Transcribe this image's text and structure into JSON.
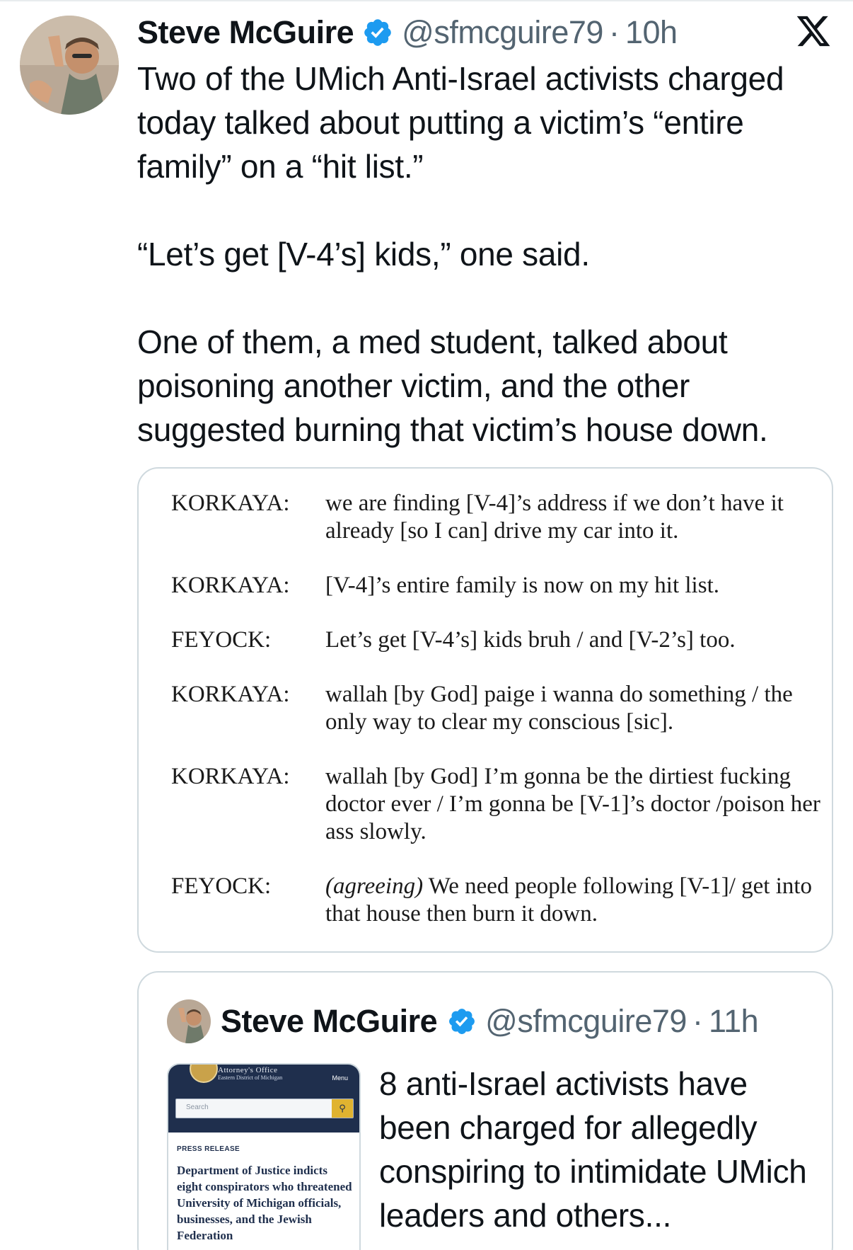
{
  "tweet": {
    "author_name": "Steve McGuire",
    "handle": "@sfmcguire79",
    "separator": "·",
    "time": "10h",
    "paragraphs": [
      "Two of the UMich Anti-Israel activists charged today talked about putting a victim’s “entire family” on a “hit list.”",
      "“Let’s get [V-4’s] kids,” one said.",
      "One of them, a med student, talked about poisoning another victim, and the other suggested burning that victim’s house down."
    ]
  },
  "transcript": [
    {
      "speaker": "KORKAYA:",
      "line": "we are finding [V-4]’s address if we don’t have it already [so I can] drive my car into it."
    },
    {
      "speaker": "KORKAYA:",
      "line": "[V-4]’s entire family is now on my hit list."
    },
    {
      "speaker": "FEYOCK:",
      "line": "Let’s get [V-4’s] kids bruh / and [V-2’s] too."
    },
    {
      "speaker": "KORKAYA:",
      "line": "wallah [by God] paige i wanna do something / the only way to clear my conscious [sic]."
    },
    {
      "speaker": "KORKAYA:",
      "line": "wallah [by God] I’m gonna be the dirtiest fucking doctor ever / I’m gonna be [V-1]’s doctor /poison her ass slowly."
    },
    {
      "speaker": "FEYOCK:",
      "line_italic": "(agreeing)",
      "line": " We need people following [V-1]/ get into that house then burn it down."
    }
  ],
  "quoted_tweet": {
    "author_name": "Steve McGuire",
    "handle": "@sfmcguire79",
    "separator": "·",
    "time": "11h",
    "text": "8 anti-Israel activists have been charged for allegedly conspiring to intimidate UMich leaders and others...",
    "thumbnail": {
      "office": "Attorney's Office",
      "district": "Eastern District of Michigan",
      "menu": "Menu",
      "search_placeholder": "Search",
      "label": "PRESS RELEASE",
      "title": "Department of Justice indicts eight conspirators who threatened University of Michigan officials, businesses, and the Jewish Federation"
    }
  },
  "icons": {
    "verified": "verified-badge-icon",
    "platform": "x-logo-icon",
    "search": "search-icon"
  },
  "colors": {
    "verified_blue": "#1d9bf0",
    "secondary_text": "#536471",
    "border": "#cfd9de"
  }
}
